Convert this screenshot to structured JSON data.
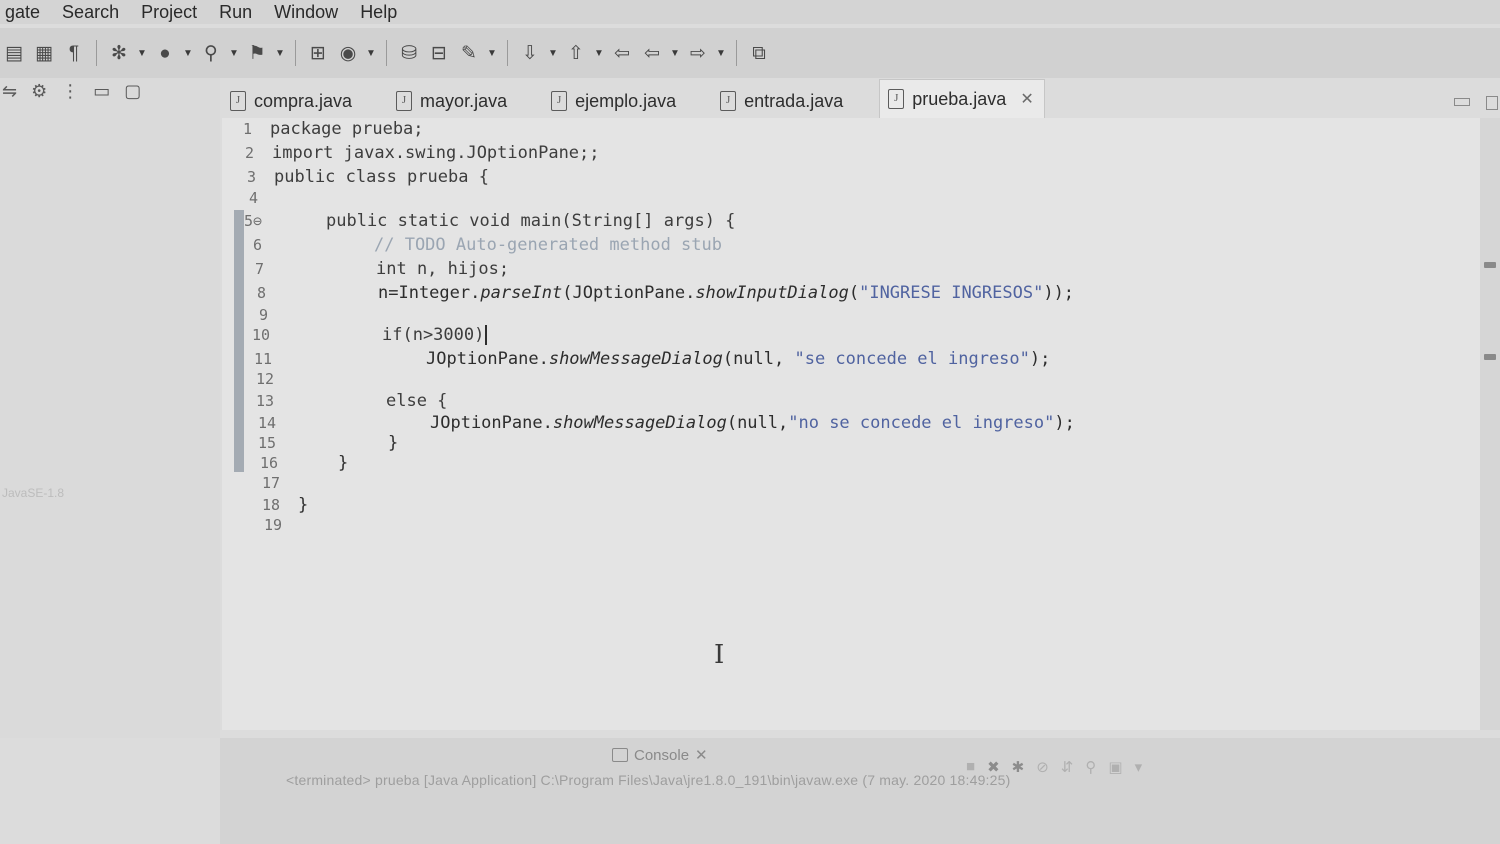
{
  "menu": [
    "gate",
    "Search",
    "Project",
    "Run",
    "Window",
    "Help"
  ],
  "toolbar_icons": [
    "save-all-icon",
    "print-icon",
    "pilcrow-icon",
    "debug-icon",
    "run-icon",
    "external-tools-icon",
    "coverage-icon",
    "new-java-package-icon",
    "new-class-icon",
    "open-type-icon",
    "open-task-icon",
    "search-icon",
    "next-annotation-icon",
    "previous-annotation-icon",
    "back-icon",
    "forward-icon",
    "open-perspective-icon"
  ],
  "tabs": [
    {
      "label": "compra.java"
    },
    {
      "label": "mayor.java"
    },
    {
      "label": "ejemplo.java"
    },
    {
      "label": "entrada.java"
    },
    {
      "label": "prueba.java",
      "active": true
    }
  ],
  "left_panel": {
    "faint_label": "JavaSE-1.8"
  },
  "code": {
    "numbers": [
      "1",
      "2",
      "3",
      "4",
      "5⊖",
      "6",
      "7",
      "8",
      "9",
      "10",
      "11",
      "12",
      "13",
      "14",
      "15",
      "16",
      "17",
      "18",
      "19"
    ],
    "l1": "package prueba;",
    "l2": "import javax.swing.JOptionPane;;",
    "l3": "public class prueba {",
    "l5": "public static void main(String[] args) {",
    "l6": "// TODO Auto-generated method stub",
    "l7": "int n, hijos;",
    "l8_a": "n=Integer.",
    "l8_b": "parseInt",
    "l8_c": "(JOptionPane.",
    "l8_d": "showInputDialog",
    "l8_e": "(",
    "l8_f": "\"INGRESE INGRESOS\"",
    "l8_g": "));",
    "l10": "if(n>3000)",
    "l11_a": "JOptionPane.",
    "l11_b": "showMessageDialog",
    "l11_c": "(null, ",
    "l11_d": "\"se concede el ingreso\"",
    "l11_e": ");",
    "l13": "else {",
    "l14_a": "JOptionPane.",
    "l14_b": "showMessageDialog",
    "l14_c": "(null,",
    "l14_d": "\"no se concede el ingreso\"",
    "l14_e": ");",
    "l15": "}",
    "l16": "}",
    "l18": "}"
  },
  "console": {
    "tab_label": "Console",
    "text": "<terminated> prueba [Java Application] C:\\Program Files\\Java\\jre1.8.0_191\\bin\\javaw.exe (7 may. 2020 18:49:25)"
  },
  "colors": {
    "comment": "#9aa5b2",
    "string": "#5063a0",
    "keyword": "#3d3d3d"
  }
}
